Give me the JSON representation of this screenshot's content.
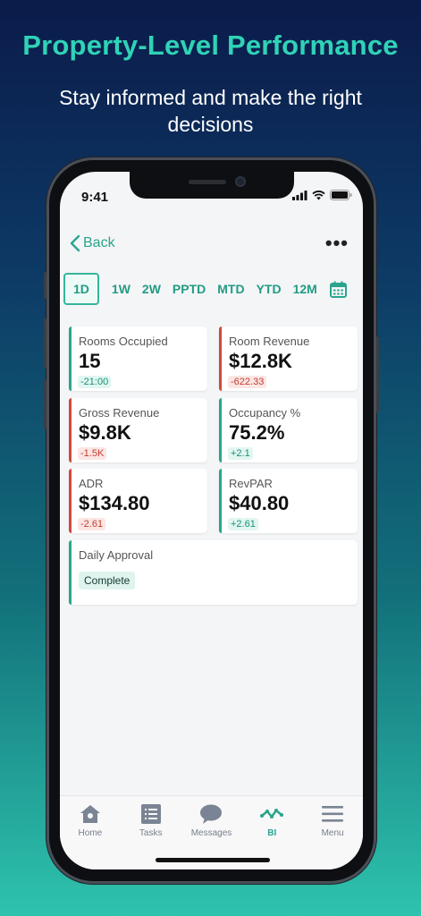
{
  "promo": {
    "headline": "Property-Level Performance",
    "subline": "Stay informed and make the right decisions"
  },
  "status_bar": {
    "time": "9:41"
  },
  "nav": {
    "back_label": "Back",
    "more_label": "•••"
  },
  "periods": [
    {
      "label": "1D",
      "active": true
    },
    {
      "label": "1W"
    },
    {
      "label": "2W"
    },
    {
      "label": "PPTD"
    },
    {
      "label": "MTD"
    },
    {
      "label": "YTD"
    },
    {
      "label": "12M"
    }
  ],
  "kpis": [
    {
      "label": "Rooms Occupied",
      "value": "15",
      "delta": "-21:00",
      "trend": "positive"
    },
    {
      "label": "Room Revenue",
      "value": "$12.8K",
      "delta": "-622.33",
      "trend": "negative"
    },
    {
      "label": "Gross Revenue",
      "value": "$9.8K",
      "delta": "-1.5K",
      "trend": "negative"
    },
    {
      "label": "Occupancy %",
      "value": "75.2%",
      "delta": "+2.1",
      "trend": "positive"
    },
    {
      "label": "ADR",
      "value": "$134.80",
      "delta": "-2.61",
      "trend": "negative"
    },
    {
      "label": "RevPAR",
      "value": "$40.80",
      "delta": "+2.61",
      "trend": "positive"
    }
  ],
  "approval": {
    "label": "Daily Approval",
    "status": "Complete"
  },
  "tabbar": [
    {
      "label": "Home",
      "icon": "home-icon"
    },
    {
      "label": "Tasks",
      "icon": "list-icon"
    },
    {
      "label": "Messages",
      "icon": "chat-bubble-icon"
    },
    {
      "label": "BI",
      "icon": "pulse-icon",
      "active": true
    },
    {
      "label": "Menu",
      "icon": "hamburger-menu-icon"
    }
  ],
  "colors": {
    "accent": "#2aa58d",
    "positive_bar": "#2aa58d",
    "negative_bar": "#d0483d",
    "headline": "#2fd3b6"
  }
}
